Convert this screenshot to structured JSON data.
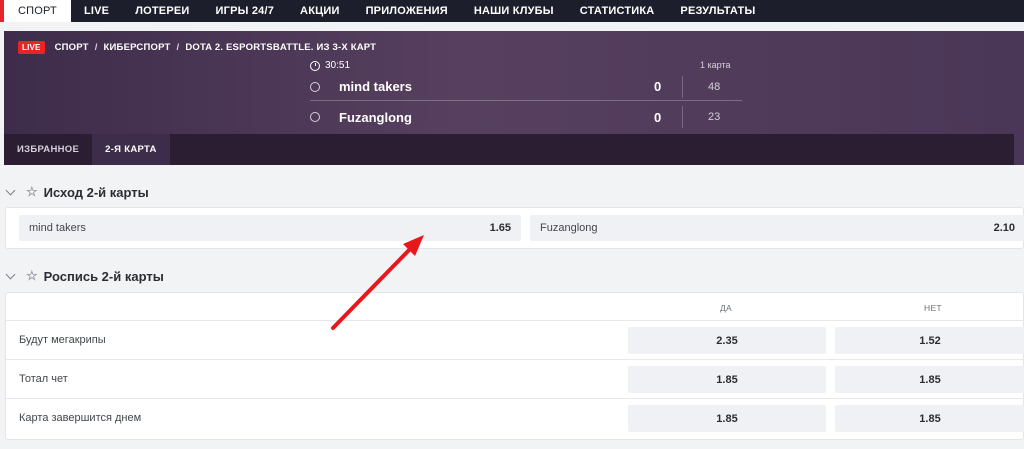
{
  "nav": {
    "items": [
      "СПОРТ",
      "LIVE",
      "ЛОТЕРЕИ",
      "ИГРЫ 24/7",
      "АКЦИИ",
      "ПРИЛОЖЕНИЯ",
      "НАШИ КЛУБЫ",
      "СТАТИСТИКА",
      "РЕЗУЛЬТАТЫ"
    ],
    "active": "СПОРТ"
  },
  "match": {
    "live_badge": "LIVE",
    "breadcrumb": [
      "СПОРТ",
      "КИБЕРСПОРТ",
      "DOTA 2. ESPORTSBATTLE. ИЗ 3-Х КАРТ"
    ],
    "breadcrumb_sep": "/",
    "timer": "30:51",
    "map_label": "1 карта",
    "teams": [
      {
        "name": "mind takers",
        "score": "0",
        "map_score": "48"
      },
      {
        "name": "Fuzanglong",
        "score": "0",
        "map_score": "23"
      }
    ],
    "tabs": [
      {
        "label": "ИЗБРАННОЕ",
        "active": false
      },
      {
        "label": "2-Я КАРТА",
        "active": true
      }
    ]
  },
  "market1": {
    "title": "Исход 2-й карты",
    "outcomes": [
      {
        "name": "mind takers",
        "odd": "1.65"
      },
      {
        "name": "Fuzanglong",
        "odd": "2.10"
      }
    ]
  },
  "market2": {
    "title": "Роспись 2-й карты",
    "col_yes": "ДА",
    "col_no": "НЕТ",
    "rows": [
      {
        "label": "Будут мегакрипы",
        "yes": "2.35",
        "no": "1.52"
      },
      {
        "label": "Тотал чет",
        "yes": "1.85",
        "no": "1.85"
      },
      {
        "label": "Карта завершится днем",
        "yes": "1.85",
        "no": "1.85"
      }
    ]
  },
  "colors": {
    "accent_red": "#e4262b",
    "nav_bg": "#1c1e2b",
    "header_purple": "#4a3656",
    "arrow": "#e8171c"
  },
  "icons": [
    "clock-icon",
    "chevron-down-icon",
    "star-icon",
    "team-circle-icon"
  ]
}
